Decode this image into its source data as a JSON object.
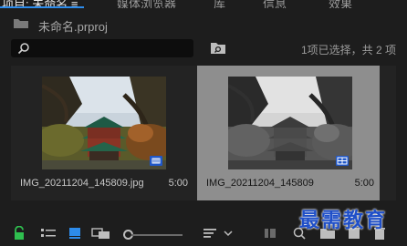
{
  "tabs": [
    {
      "label": "项目: 未命名 ≡"
    },
    {
      "label": "媒体浏览器"
    },
    {
      "label": "库"
    },
    {
      "label": "信息"
    },
    {
      "label": "效果"
    }
  ],
  "project": {
    "name": "未命名.prproj"
  },
  "search": {
    "value": ""
  },
  "selection_status": "1项已选择，共 2 项",
  "items": [
    {
      "name": "IMG_20211204_145809.jpg",
      "duration": "5:00"
    },
    {
      "name": "IMG_20211204_145809",
      "duration": "5:00"
    }
  ],
  "watermark": "最需教育",
  "colors": {
    "accent": "#2d8ceb",
    "selected_card_bg": "#8e8e8e",
    "lock_green": "#2fbf4f"
  }
}
